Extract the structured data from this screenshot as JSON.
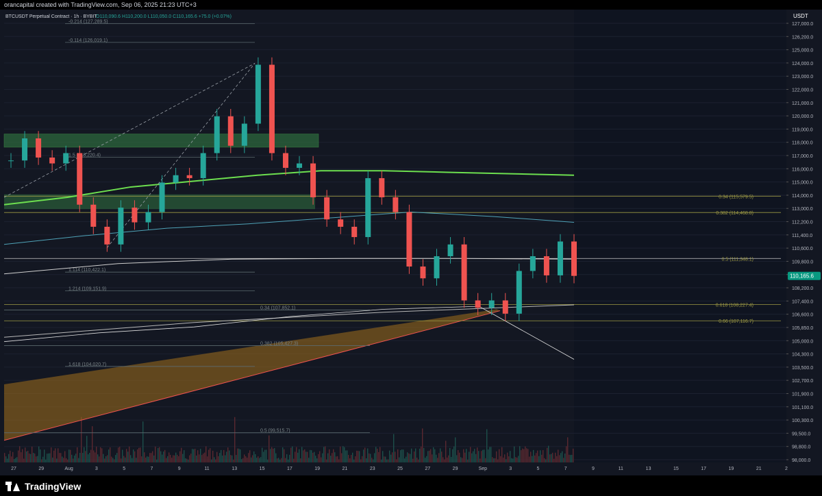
{
  "header": {
    "credit": "orancapital created with TradingView.com, Sep 06, 2025 21:23 UTC+3"
  },
  "legend": {
    "symbol": "BTCUSDT Perpetual Contract · 1h · BYBIT",
    "ohlc": "O110,090.6 H110,200.0 L110,050.0 C110,165.6 +75.0 (+0.07%)"
  },
  "footer": {
    "brand": "TradingView"
  },
  "colors": {
    "background": "#131722",
    "up": "#26a69a",
    "down": "#ef5350",
    "fib": "#9e9a44",
    "green_zone": "#2e6b3e",
    "orange_band": "#a3701c",
    "sma_green": "#6ddf4f",
    "sma_blue": "#4fa3b8",
    "vwap_white": "#d0d0d0",
    "price_tag": "#089981"
  },
  "chart_data": {
    "type": "candlestick",
    "title": "",
    "currency": "USDT",
    "ylim": [
      97500,
      127500
    ],
    "y_ticks": [
      "127,000.0",
      "126,200.0",
      "125,000.0",
      "124,000.0",
      "123,000.0",
      "122,000.0",
      "121,000.0",
      "120,000.0",
      "119,000.0",
      "118,000.0",
      "117,000.0",
      "116,000.0",
      "115,000.0",
      "114,000.0",
      "113,000.0",
      "112,200.0",
      "111,400.0",
      "110,600.0",
      "109,800.0",
      "109,000.0",
      "108,200.0",
      "107,400.0",
      "106,600.0",
      "105,850.0",
      "105,000.0",
      "104,300.0",
      "103,500.0",
      "102,700.0",
      "101,900.0",
      "101,100.0",
      "100,300.0",
      "99,500.0",
      "98,800.0",
      "98,000.0"
    ],
    "x_ticks": [
      "27",
      "29",
      "Aug",
      "3",
      "5",
      "7",
      "9",
      "11",
      "13",
      "15",
      "17",
      "19",
      "21",
      "23",
      "25",
      "27",
      "29",
      "Sep",
      "3",
      "5",
      "7",
      "9",
      "11",
      "13",
      "15",
      "17",
      "19",
      "21",
      "2"
    ],
    "last_price": "110,165.6",
    "close_series": [
      {
        "t": "Jul 27",
        "close": 118000
      },
      {
        "t": "Jul 28",
        "close": 119500
      },
      {
        "t": "Jul 29",
        "close": 118200
      },
      {
        "t": "Jul 30",
        "close": 117800
      },
      {
        "t": "Jul 31",
        "close": 118500
      },
      {
        "t": "Aug 1",
        "close": 115000
      },
      {
        "t": "Aug 2",
        "close": 113500
      },
      {
        "t": "Aug 3",
        "close": 112300
      },
      {
        "t": "Aug 4",
        "close": 114800
      },
      {
        "t": "Aug 5",
        "close": 113800
      },
      {
        "t": "Aug 6",
        "close": 114500
      },
      {
        "t": "Aug 7",
        "close": 116500
      },
      {
        "t": "Aug 8",
        "close": 117000
      },
      {
        "t": "Aug 9",
        "close": 116800
      },
      {
        "t": "Aug 10",
        "close": 118500
      },
      {
        "t": "Aug 11",
        "close": 121000
      },
      {
        "t": "Aug 12",
        "close": 119000
      },
      {
        "t": "Aug 13",
        "close": 120500
      },
      {
        "t": "Aug 14",
        "close": 124500
      },
      {
        "t": "Aug 15",
        "close": 118500
      },
      {
        "t": "Aug 16",
        "close": 117500
      },
      {
        "t": "Aug 17",
        "close": 117800
      },
      {
        "t": "Aug 18",
        "close": 115500
      },
      {
        "t": "Aug 19",
        "close": 114000
      },
      {
        "t": "Aug 20",
        "close": 113500
      },
      {
        "t": "Aug 21",
        "close": 112800
      },
      {
        "t": "Aug 22",
        "close": 116800
      },
      {
        "t": "Aug 23",
        "close": 115500
      },
      {
        "t": "Aug 24",
        "close": 114500
      },
      {
        "t": "Aug 25",
        "close": 110800
      },
      {
        "t": "Aug 26",
        "close": 110000
      },
      {
        "t": "Aug 27",
        "close": 111500
      },
      {
        "t": "Aug 28",
        "close": 112300
      },
      {
        "t": "Aug 29",
        "close": 108500
      },
      {
        "t": "Aug 30",
        "close": 108000
      },
      {
        "t": "Aug 31",
        "close": 108500
      },
      {
        "t": "Sep 1",
        "close": 107600
      },
      {
        "t": "Sep 2",
        "close": 110500
      },
      {
        "t": "Sep 3",
        "close": 111500
      },
      {
        "t": "Sep 4",
        "close": 110200
      },
      {
        "t": "Sep 5",
        "close": 112500
      },
      {
        "t": "Sep 6",
        "close": 110165.6
      }
    ],
    "fib_right": [
      {
        "label": "0.34 (115,579.5)",
        "value": 115579.5
      },
      {
        "label": "0.382 (114,468.8)",
        "value": 114468.8
      },
      {
        "label": "0.5 (111,348.1)",
        "value": 111348.1
      },
      {
        "label": "0.618 (108,227.4)",
        "value": 108227.4
      },
      {
        "label": "0.66 (107,116.7)",
        "value": 107116.7
      }
    ],
    "fib_left": [
      {
        "label": "-0.214 (127,289.5)",
        "value": 127289.5
      },
      {
        "label": "-0.114 (126,019.1)",
        "value": 126019.1
      },
      {
        "label": "1.5 (118,220.4)",
        "value": 118220.4
      },
      {
        "label": "1.114 (110,422.1)",
        "value": 110422.1
      },
      {
        "label": "1.214 (109,151.9)",
        "value": 109151.9
      },
      {
        "label": "1.618 (104,020.7)",
        "value": 104020.7
      }
    ],
    "fib_mid": [
      {
        "label": "0.34 (107,852.1)",
        "value": 107852.1
      },
      {
        "label": "0.382 (105,427.3)",
        "value": 105427.3
      },
      {
        "label": "0.5 (99,515.7)",
        "value": 99515.7
      }
    ],
    "zones": [
      {
        "name": "supply",
        "from": 118900,
        "to": 119800
      },
      {
        "name": "demand",
        "from": 114700,
        "to": 115700
      }
    ],
    "sma_green": [
      115000,
      115500,
      116200,
      116600,
      117000,
      117300,
      117300,
      117200,
      117100,
      117000
    ],
    "sma_blue": [
      112300,
      112900,
      113400,
      113700,
      114100,
      114500,
      114200,
      113800
    ],
    "vwap": [
      110300,
      111000,
      111300,
      111350,
      111350,
      111300
    ],
    "lower_band": [
      106000,
      107000,
      107700,
      108200
    ],
    "long_ma": [
      105700,
      106300,
      106700,
      107400,
      107900,
      108100,
      104500
    ],
    "orange_band": {
      "start": [
        102800,
        99000
      ],
      "end": [
        107900,
        107800
      ]
    }
  }
}
